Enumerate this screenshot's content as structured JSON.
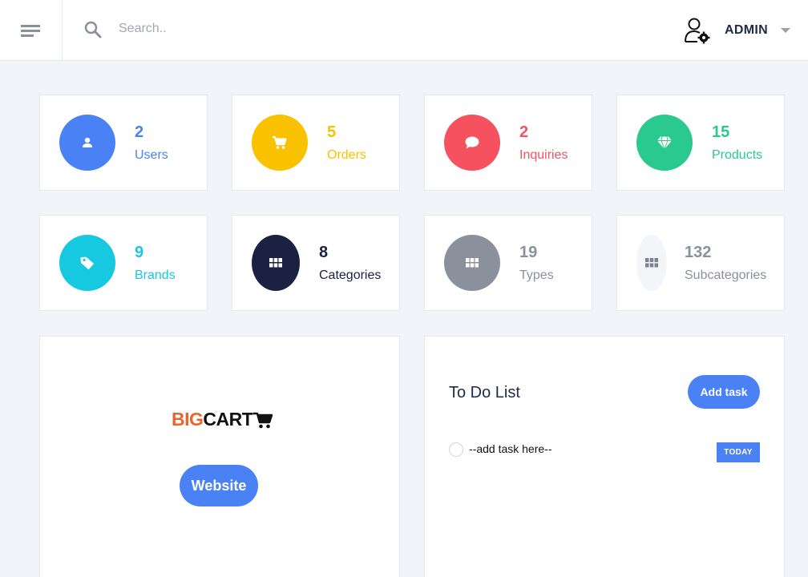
{
  "header": {
    "search_placeholder": "Search..",
    "user_name": "ADMIN"
  },
  "stats": [
    {
      "count": "2",
      "label": "Users",
      "color": "#4a82f5",
      "icon": "user-icon"
    },
    {
      "count": "5",
      "label": "Orders",
      "color": "#f9c200",
      "icon": "cart-icon"
    },
    {
      "count": "2",
      "label": "Inquiries",
      "color": "#f5515f",
      "icon": "chat-icon"
    },
    {
      "count": "15",
      "label": "Products",
      "color": "#29c98f",
      "icon": "diamond-icon"
    },
    {
      "count": "9",
      "label": "Brands",
      "color": "#17c9e0",
      "icon": "tag-icon"
    },
    {
      "count": "8",
      "label": "Categories",
      "color": "#1b2140",
      "icon": "grid-icon"
    },
    {
      "count": "19",
      "label": "Types",
      "color": "#8a909c",
      "icon": "grid-icon"
    },
    {
      "count": "132",
      "label": "Subcategories",
      "color": "#f4f5f9",
      "icon": "grid-icon"
    }
  ],
  "website_panel": {
    "logo_part1": "BIG",
    "logo_part2": "CART",
    "button_label": "Website"
  },
  "todo": {
    "title": "To Do List",
    "add_button": "Add task",
    "items": [
      {
        "text": "--add task here--",
        "badge": "TODAY"
      }
    ]
  }
}
